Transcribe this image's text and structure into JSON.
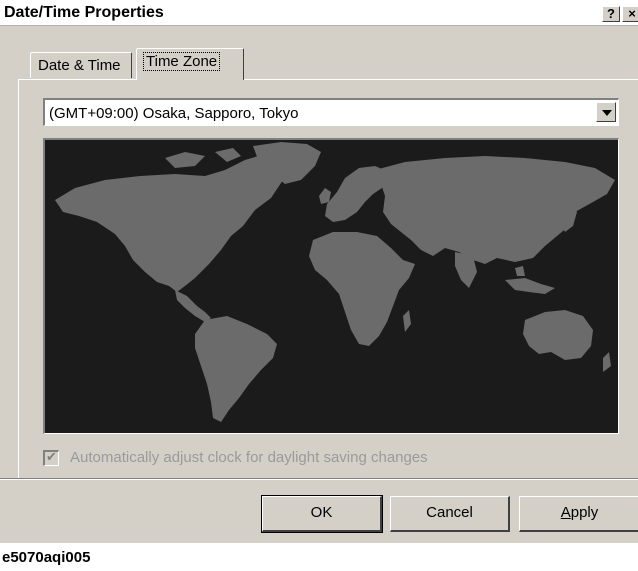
{
  "window": {
    "title": "Date/Time Properties",
    "help_button": "?",
    "close_button": "×"
  },
  "tabs": [
    {
      "label": "Date & Time",
      "active": false
    },
    {
      "label": "Time Zone",
      "active": true
    }
  ],
  "timezone": {
    "selected": "(GMT+09:00) Osaka, Sapporo, Tokyo"
  },
  "map": {
    "ocean_color": "#1b1b1b",
    "land_color": "#6b6b6b"
  },
  "dst": {
    "label": "Automatically adjust clock for daylight saving changes",
    "checked": true,
    "enabled": false
  },
  "buttons": {
    "ok": "OK",
    "cancel": "Cancel",
    "apply_underlined": "A",
    "apply_rest": "pply"
  },
  "caption": "e5070aqi005"
}
